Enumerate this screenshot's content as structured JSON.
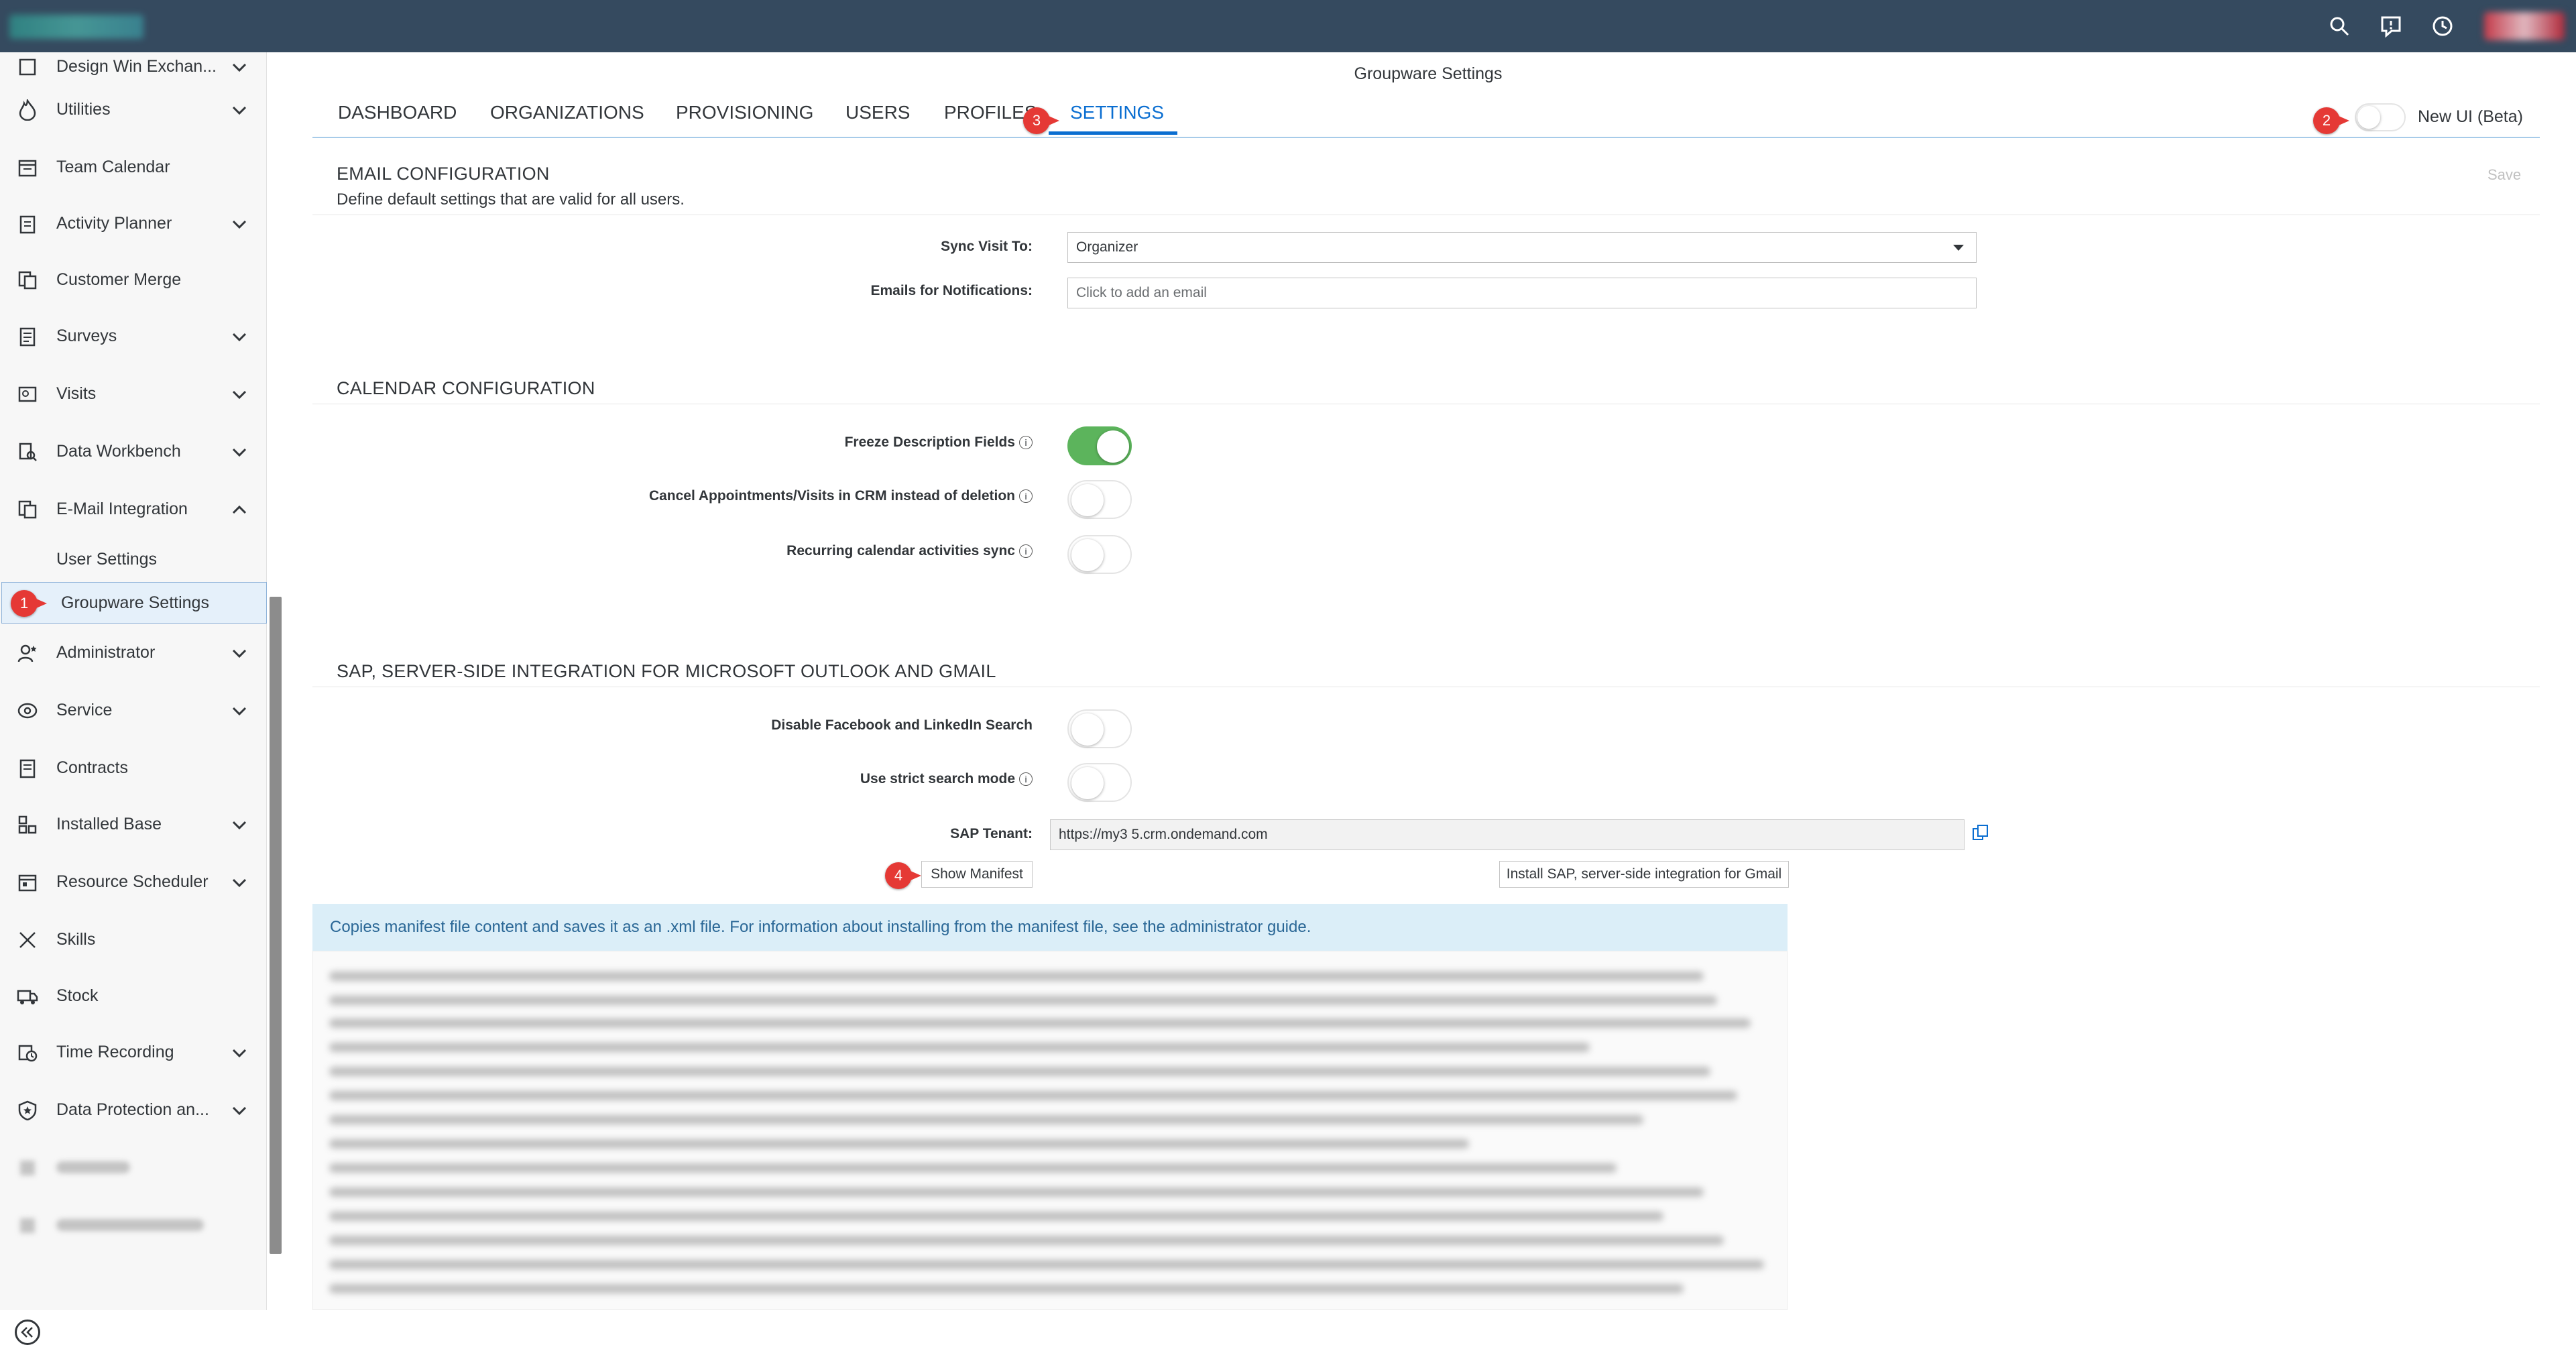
{
  "shell": {
    "icons": [
      "search-icon",
      "feedback-icon",
      "clock-icon"
    ]
  },
  "sidebar": {
    "items": [
      {
        "label": "Design Win Exchan...",
        "icon": "design-icon"
      },
      {
        "label": "Utilities",
        "icon": "flame-icon"
      },
      {
        "label": "Team Calendar",
        "icon": "calendar-icon"
      },
      {
        "label": "Activity Planner",
        "icon": "clipboard-icon"
      },
      {
        "label": "Customer Merge",
        "icon": "merge-icon"
      },
      {
        "label": "Surveys",
        "icon": "survey-icon"
      },
      {
        "label": "Visits",
        "icon": "visit-icon"
      },
      {
        "label": "Data Workbench",
        "icon": "workbench-icon"
      },
      {
        "label": "E-Mail Integration",
        "icon": "email-integration-icon"
      },
      {
        "label": "Administrator",
        "icon": "administrator-icon"
      },
      {
        "label": "Service",
        "icon": "service-icon"
      },
      {
        "label": "Contracts",
        "icon": "contracts-icon"
      },
      {
        "label": "Installed Base",
        "icon": "installed-base-icon"
      },
      {
        "label": "Resource Scheduler",
        "icon": "scheduler-icon"
      },
      {
        "label": "Skills",
        "icon": "skills-icon"
      },
      {
        "label": "Stock",
        "icon": "stock-icon"
      },
      {
        "label": "Time Recording",
        "icon": "time-recording-icon"
      },
      {
        "label": "Data Protection an...",
        "icon": "data-protection-icon"
      }
    ],
    "sub_items": [
      "User Settings",
      "Groupware Settings"
    ]
  },
  "page": {
    "title": "Groupware Settings",
    "tabs": [
      "DASHBOARD",
      "ORGANIZATIONS",
      "PROVISIONING",
      "USERS",
      "PROFILES",
      "SETTINGS"
    ],
    "active_tab": "SETTINGS",
    "new_ui_label": "New UI (Beta)",
    "new_ui_enabled": false
  },
  "badges": [
    "1",
    "2",
    "3",
    "4"
  ],
  "email_config": {
    "title": "EMAIL CONFIGURATION",
    "description": "Define default settings that are valid for all users.",
    "save_label": "Save",
    "sync_label": "Sync Visit To:",
    "sync_value": "Organizer",
    "emails_label": "Emails for Notifications:",
    "emails_placeholder": "Click to add an email"
  },
  "calendar_config": {
    "title": "CALENDAR CONFIGURATION",
    "settings": [
      {
        "label": "Freeze Description Fields",
        "enabled": true
      },
      {
        "label": "Cancel Appointments/Visits in CRM instead of deletion",
        "enabled": false
      },
      {
        "label": "Recurring calendar activities sync",
        "enabled": false
      }
    ]
  },
  "sap_integration": {
    "title": "SAP, SERVER-SIDE INTEGRATION FOR MICROSOFT OUTLOOK AND GMAIL",
    "settings": [
      {
        "label": "Disable Facebook and LinkedIn Search",
        "enabled": false
      },
      {
        "label": "Use strict search mode",
        "enabled": false
      }
    ],
    "tenant_label": "SAP Tenant:",
    "tenant_value": "https://my3      5.crm.ondemand.com",
    "show_manifest_label": "Show Manifest",
    "install_gmail_label": "Install SAP, server-side integration for Gmail",
    "info_text": "Copies manifest file content and saves it as an .xml file. For information about installing from the manifest file, see the administrator guide."
  },
  "colors": {
    "shell": "#354a5f",
    "accent": "#0a6ed1",
    "toggle_on": "#5cb45c",
    "badge": "#e53935"
  }
}
